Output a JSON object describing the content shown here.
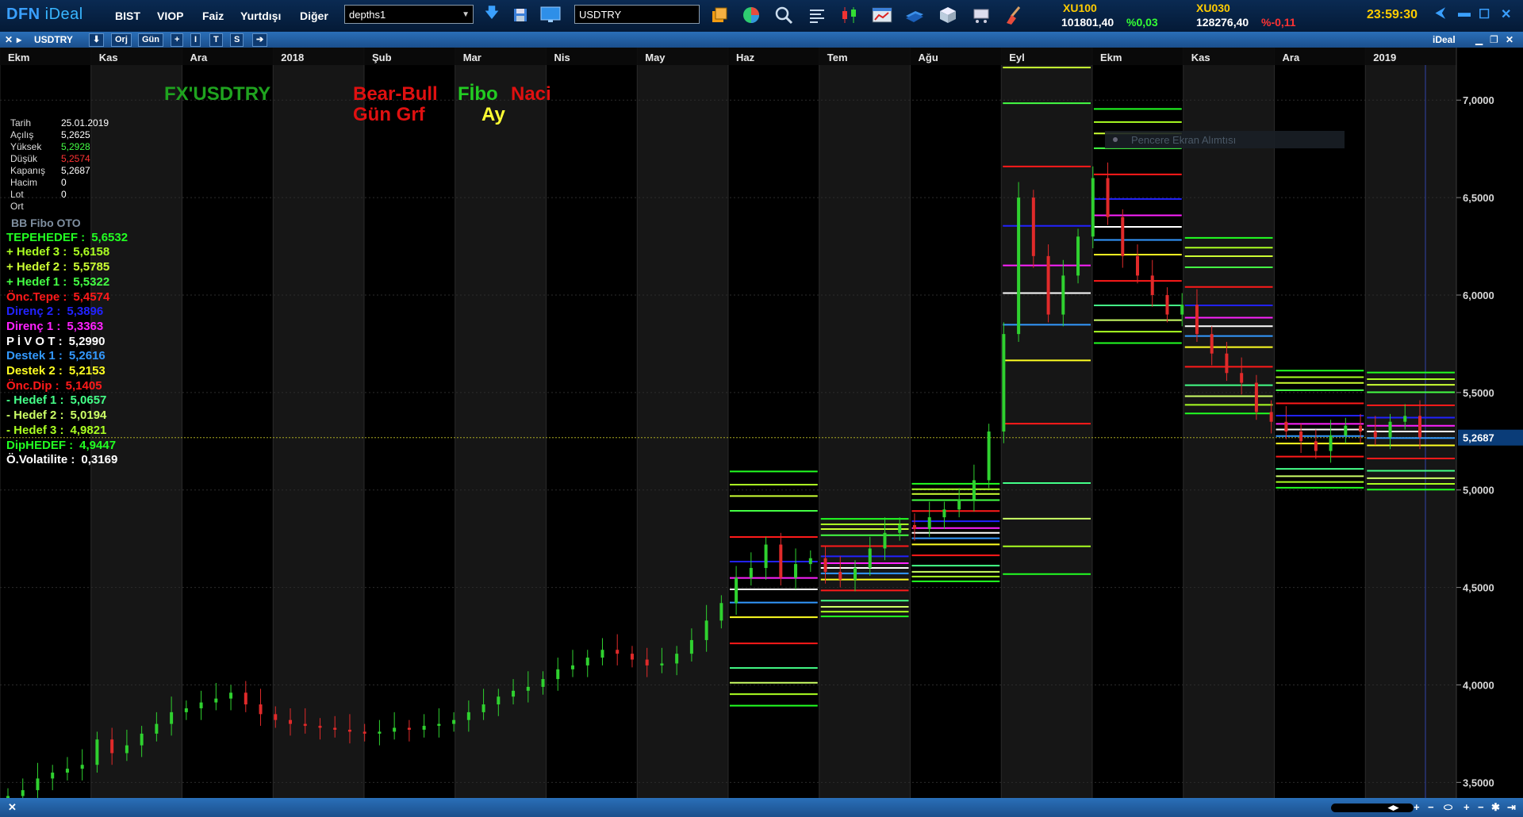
{
  "app": {
    "logo_a": "DFN",
    "logo_b": "iDeal"
  },
  "menu": [
    "BIST",
    "VIOP",
    "Faiz",
    "Yurtdışı",
    "Diğer"
  ],
  "depth_combo": "depths1",
  "symbol_input": "USDTRY",
  "tickers": [
    {
      "name": "XU100",
      "value": "101801,40",
      "change": "%0,03",
      "direction": "up"
    },
    {
      "name": "XU030",
      "value": "128276,40",
      "change": "%-0,11",
      "direction": "down"
    }
  ],
  "clock": "23:59:30",
  "subbar": {
    "symbol": "USDTRY",
    "buttons": [
      "Orj",
      "Gün",
      "+",
      "I",
      "T",
      "S",
      "➔"
    ],
    "right_label": "iDeal"
  },
  "chart_data": {
    "type": "candlestick",
    "symbol": "USDTRY",
    "timeframe": "Gün",
    "months": [
      "Ekm",
      "Kas",
      "Ara",
      "2018",
      "Şub",
      "Mar",
      "Nis",
      "May",
      "Haz",
      "Tem",
      "Ağu",
      "Eyl",
      "Ekm",
      "Kas",
      "Ara",
      "2019"
    ],
    "y_ticks": [
      "7,0000",
      "6,5000",
      "6,0000",
      "5,5000",
      "5,0000",
      "4,5000",
      "4,0000",
      "3,5000"
    ],
    "ylim": [
      3.42,
      7.18
    ],
    "last_price": "5,2687",
    "title_labels": [
      "FX'USDTRY",
      "Bear-Bull",
      "Fİbo",
      "Naci",
      "Gün Grf",
      "Ay"
    ],
    "tooltip": "Pencere Ekran Alımtısı",
    "close_series": [
      3.43,
      3.46,
      3.52,
      3.55,
      3.57,
      3.59,
      3.72,
      3.65,
      3.69,
      3.75,
      3.8,
      3.86,
      3.88,
      3.91,
      3.93,
      3.96,
      3.9,
      3.85,
      3.82,
      3.8,
      3.79,
      3.78,
      3.77,
      3.76,
      3.75,
      3.76,
      3.78,
      3.77,
      3.79,
      3.8,
      3.82,
      3.86,
      3.9,
      3.94,
      3.97,
      3.99,
      4.03,
      4.08,
      4.1,
      4.14,
      4.18,
      4.16,
      4.13,
      4.1,
      4.11,
      4.16,
      4.23,
      4.33,
      4.42,
      4.55,
      4.6,
      4.72,
      4.55,
      4.62,
      4.65,
      4.58,
      4.54,
      4.6,
      4.7,
      4.78,
      4.82,
      4.8,
      4.86,
      4.9,
      4.95,
      5.05,
      5.3,
      5.8,
      6.5,
      6.2,
      5.9,
      6.1,
      6.3,
      6.6,
      6.4,
      6.2,
      6.1,
      6.0,
      5.9,
      5.95,
      5.8,
      5.7,
      5.6,
      5.55,
      5.4,
      5.35,
      5.3,
      5.25,
      5.2,
      5.28,
      5.33,
      5.3,
      5.27,
      5.35,
      5.38,
      5.27
    ],
    "fibo_levels": [
      {
        "label": "TEPEHEDEF :",
        "value": "5,6532",
        "color": "#22ff22"
      },
      {
        "label": "+ Hedef 3 :",
        "value": "5,6158",
        "color": "#aaff22"
      },
      {
        "label": "+ Hedef 2 :",
        "value": "5,5785",
        "color": "#ccff33"
      },
      {
        "label": "+ Hedef 1 :",
        "value": "5,5322",
        "color": "#44ff44"
      },
      {
        "label": "Önc.Tepe :",
        "value": "5,4574",
        "color": "#ff1a1a"
      },
      {
        "label": "Direnç 2  :",
        "value": "5,3896",
        "color": "#2222ff"
      },
      {
        "label": "Direnç 1  :",
        "value": "5,3363",
        "color": "#ff22ff"
      },
      {
        "label": "P İ V O T  :",
        "value": "5,2990",
        "color": "#ffffff"
      },
      {
        "label": "Destek 1  :",
        "value": "5,2616",
        "color": "#3399ff"
      },
      {
        "label": "Destek 2  :",
        "value": "5,2153",
        "color": "#ffff22"
      },
      {
        "label": "Önc.Dip  :",
        "value": "5,1405",
        "color": "#ff1a1a"
      },
      {
        "label": "- Hedef 1 :",
        "value": "5,0657",
        "color": "#44ff88"
      },
      {
        "label": "- Hedef 2 :",
        "value": "5,0194",
        "color": "#ccff66"
      },
      {
        "label": "- Hedef 3 :",
        "value": "4,9821",
        "color": "#aaff22"
      },
      {
        "label": "DipHEDEF :",
        "value": "4,9447",
        "color": "#22ff22"
      },
      {
        "label": "Ö.Volatilite :",
        "value": "0,3169",
        "color": "#ffffff"
      }
    ],
    "monthly_blocks": [
      {
        "month": "Haz",
        "tepe": 4.97,
        "pivot": 4.49,
        "dip": 4.06,
        "range": 0.6
      },
      {
        "month": "Tem",
        "tepe": 4.93,
        "pivot": 4.6,
        "dip": 4.47,
        "range": 0.25
      },
      {
        "month": "Ağu",
        "tepe": 4.98,
        "pivot": 4.78,
        "dip": 4.55,
        "range": 0.25
      },
      {
        "month": "Eyl",
        "tepe": 7.1,
        "pivot": 6.01,
        "dip": 4.9,
        "range": 1.45
      },
      {
        "month": "Ekm",
        "tepe": 6.72,
        "pivot": 6.35,
        "dip": 5.95,
        "range": 0.6
      },
      {
        "month": "Kas",
        "tepe": 6.22,
        "pivot": 5.84,
        "dip": 5.45,
        "range": 0.45
      },
      {
        "month": "Ara",
        "tepe": 5.65,
        "pivot": 5.31,
        "dip": 5.12,
        "range": 0.3
      },
      {
        "month": "2019",
        "tepe": 5.45,
        "pivot": 5.3,
        "dip": 5.14,
        "range": 0.3
      }
    ]
  },
  "infobox": [
    {
      "label": "Tarih",
      "value": "25.01.2019",
      "color": "#ffffff"
    },
    {
      "label": "Açılış",
      "value": "5,2625",
      "color": "#ffffff"
    },
    {
      "label": "Yüksek",
      "value": "5,2928",
      "color": "#44ff44"
    },
    {
      "label": "Düşük",
      "value": "5,2574",
      "color": "#ff3333"
    },
    {
      "label": "Kapanış",
      "value": "5,2687",
      "color": "#ffffff"
    },
    {
      "label": "Hacim",
      "value": "0",
      "color": "#ffffff"
    },
    {
      "label": "Lot",
      "value": "0",
      "color": "#ffffff"
    },
    {
      "label": "Ort",
      "value": "",
      "color": "#ffffff"
    }
  ],
  "fibo_title": "BB Fibo OTO"
}
